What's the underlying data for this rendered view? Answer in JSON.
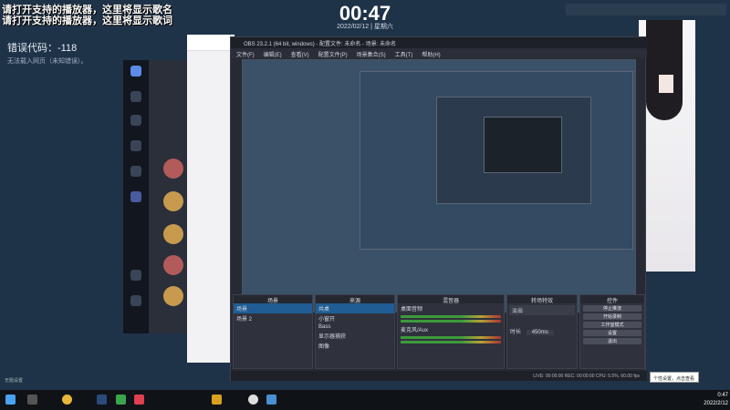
{
  "desktop": {
    "lyric_line1": "请打开支持的播放器，这里将显示歌名",
    "lyric_line2": "请打开支持的播放器，这里将显示歌词",
    "clock_time": "00:47",
    "clock_date": "2022/02/12 | 星期六",
    "error_code": "错误代码：-118",
    "error_detail": "无法载入网页（未知错误）。",
    "bottom_note": "无题设置"
  },
  "obs": {
    "title": "OBS 23.2.1 (64 bit, windows) - 配置文件: 未命名 - 场景: 未命名",
    "menu": [
      "文件(F)",
      "编辑(E)",
      "查看(V)",
      "配置文件(P)",
      "场景集合(S)",
      "工具(T)",
      "帮助(H)"
    ],
    "docks": {
      "scenes": {
        "title": "场景",
        "items": [
          "场景",
          "场景 2"
        ]
      },
      "sources": {
        "title": "来源",
        "items": [
          "共桌",
          "小窗开",
          "Bass",
          "显示器捕获",
          "图像"
        ]
      },
      "mixer": {
        "title": "混音器",
        "tracks": [
          "桌面音频",
          "麦克风/Aux"
        ]
      },
      "transitions": {
        "title": "转场特效",
        "type": "淡出",
        "duration_label": "时长",
        "duration": "450ms"
      },
      "controls": {
        "title": "控件",
        "buttons": [
          "停止推流",
          "开始录制",
          "工作室模式",
          "设置",
          "退出"
        ]
      }
    },
    "status": "LIVE: 00:00:00   REC: 00:00:00   CPU: 5.5%, 60.00 fps"
  },
  "taskbar": {
    "time": "0:47",
    "date": "2022/2/12",
    "tooltip": "个性设置，点击查看"
  },
  "colors": {
    "desktop_bg": "#1f3348",
    "obs_bg": "#272a33",
    "selected": "#1f5d94"
  },
  "icons": [
    "windows-start-icon",
    "chrome-icon",
    "steam-icon",
    "obs-icon",
    "wechat-icon",
    "folder-icon"
  ]
}
